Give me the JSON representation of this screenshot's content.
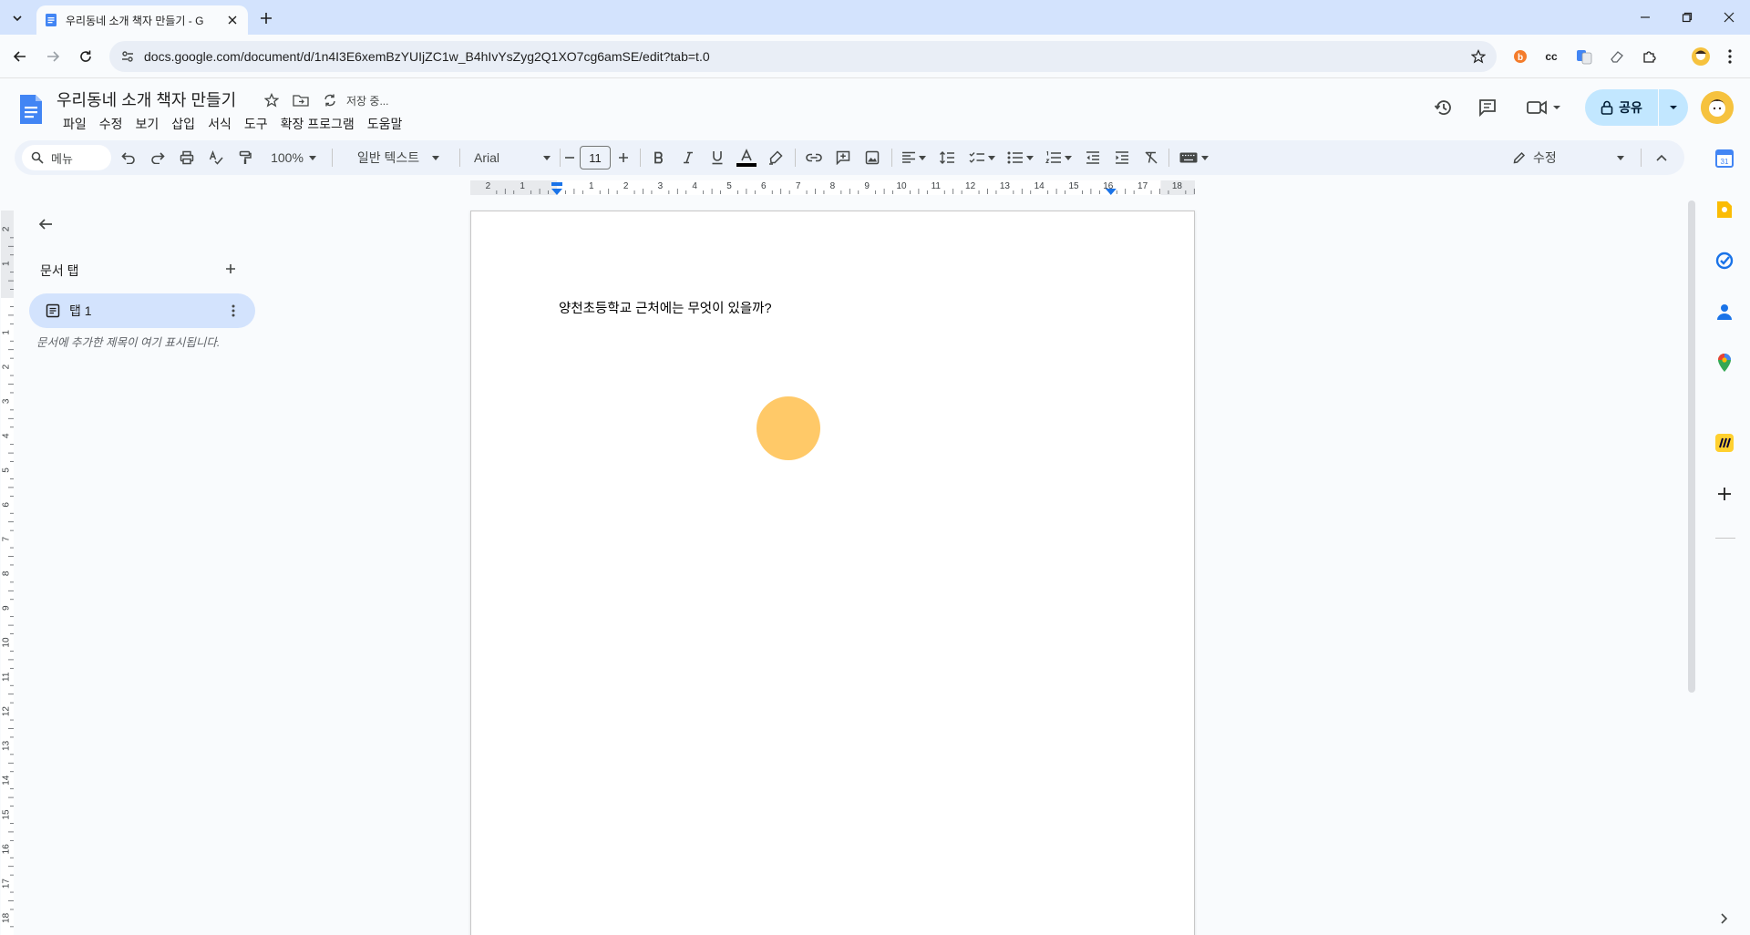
{
  "browser": {
    "tab_title": "우리동네 소개 책자 만들기 - G",
    "url": "docs.google.com/document/d/1n4I3E6xemBzYUIjZC1w_B4hIvYsZyg2Q1XO7cg6amSE/edit?tab=t.0",
    "ext_cc": "cc"
  },
  "doc": {
    "title": "우리동네 소개 책자 만들기",
    "saving": "저장 중...",
    "menus": [
      "파일",
      "수정",
      "보기",
      "삽입",
      "서식",
      "도구",
      "확장 프로그램",
      "도움말"
    ],
    "share_label": "공유"
  },
  "toolbar": {
    "search_placeholder": "메뉴",
    "zoom": "100%",
    "style": "일반 텍스트",
    "font": "Arial",
    "font_size": "11",
    "edit_mode": "수정"
  },
  "ruler": {
    "h_labels": [
      "2",
      "1",
      "1",
      "2",
      "3",
      "4",
      "5",
      "6",
      "7",
      "8",
      "9",
      "10",
      "11",
      "12",
      "13",
      "14",
      "15",
      "16",
      "17",
      "18"
    ],
    "v_labels": [
      "2",
      "1",
      "1",
      "2",
      "3",
      "4",
      "5",
      "6",
      "7",
      "8",
      "9",
      "10",
      "11",
      "12",
      "13",
      "14",
      "15",
      "16",
      "17",
      "18"
    ]
  },
  "left_panel": {
    "heading": "문서 탭",
    "tab_label": "탭 1",
    "outline_hint": "문서에 추가한 제목이 여기 표시됩니다."
  },
  "page": {
    "body_text": "양천초등학교 근처에는 무엇이 있을까?"
  },
  "colors": {
    "accent": "#0b57d0",
    "share_bg": "#c2e7ff",
    "tab_active_bg": "#d3e3fd",
    "toolbar_bg": "#edf2fa",
    "cursor_dot": "#ffc04d"
  }
}
